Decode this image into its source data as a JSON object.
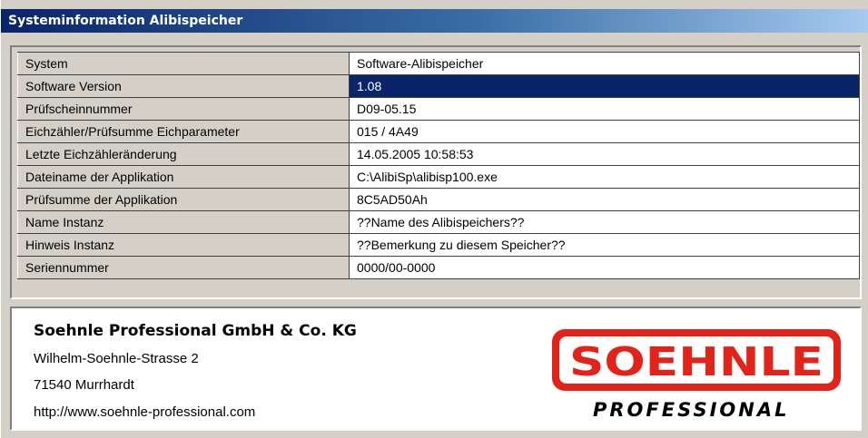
{
  "window": {
    "title": "Systeminformation Alibispeicher"
  },
  "table": {
    "rows": [
      {
        "label": "System",
        "value": "Software-Alibispeicher"
      },
      {
        "label": "Software Version",
        "value": "1.08"
      },
      {
        "label": "Prüfscheinnummer",
        "value": "D09-05.15"
      },
      {
        "label": "Eichzähler/Prüfsumme Eichparameter",
        "value": "015 / 4A49"
      },
      {
        "label": "Letzte Eichzähleränderung",
        "value": "14.05.2005 10:58:53"
      },
      {
        "label": "Dateiname der Applikation",
        "value": "C:\\AlibiSp\\alibisp100.exe"
      },
      {
        "label": "Prüfsumme der Applikation",
        "value": "8C5AD50Ah"
      },
      {
        "label": "Name Instanz",
        "value": "??Name des Alibispeichers??"
      },
      {
        "label": "Hinweis Instanz",
        "value": "??Bemerkung zu diesem Speicher??"
      },
      {
        "label": "Seriennummer",
        "value": "0000/00-0000"
      }
    ],
    "selected_row": 1
  },
  "info": {
    "company": "Soehnle Professional GmbH & Co. KG",
    "street": "Wilhelm-Soehnle-Strasse 2",
    "city": "71540 Murrhardt",
    "url": "http://www.soehnle-professional.com",
    "logo": {
      "brand": "SOEHNLE",
      "subline": "PROFESSIONAL",
      "color": "#e2231a"
    }
  }
}
